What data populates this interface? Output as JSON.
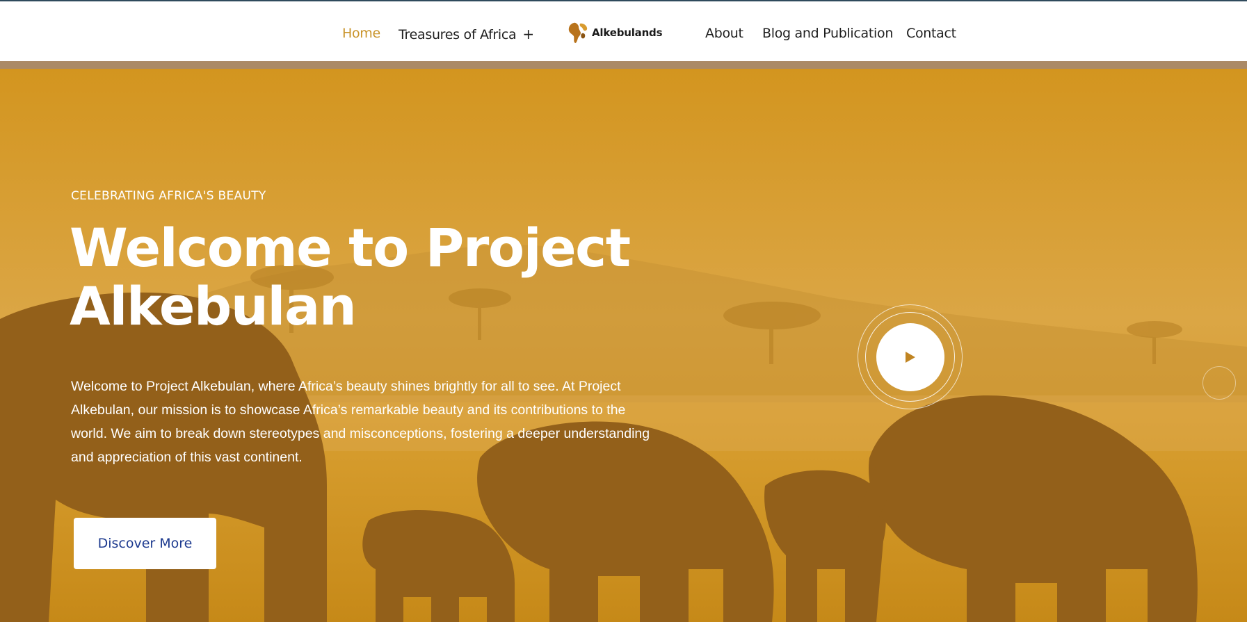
{
  "nav": {
    "items": [
      {
        "label": "Home",
        "active": true
      },
      {
        "label": "Treasures of Africa",
        "has_submenu": true,
        "submenu_glyph": "+"
      },
      {
        "label": "About"
      },
      {
        "label": "Blog and Publication"
      },
      {
        "label": "Contact"
      }
    ],
    "logo": {
      "text": "Alkebulands",
      "icon": "africa-map-logo-icon"
    },
    "active_color": "#c9942b"
  },
  "hero": {
    "eyebrow": "CELEBRATING AFRICA'S BEAUTY",
    "title": "Welcome to Project Alkebulan",
    "intro": "Welcome to Project Alkebulan, where Africa’s beauty shines brightly for all to see. At Project Alkebulan, our mission is to showcase Africa’s remarkable beauty and its contributions to the world. We aim to break down stereotypes and misconceptions, fostering a deeper understanding and appreciation of this vast continent.",
    "cta_label": "Discover More",
    "cta_color": "#1d3a8f",
    "play_icon": "play-icon",
    "background": "elephant-herd-silhouettes-sunset",
    "overlay_color": "#d59a24"
  }
}
